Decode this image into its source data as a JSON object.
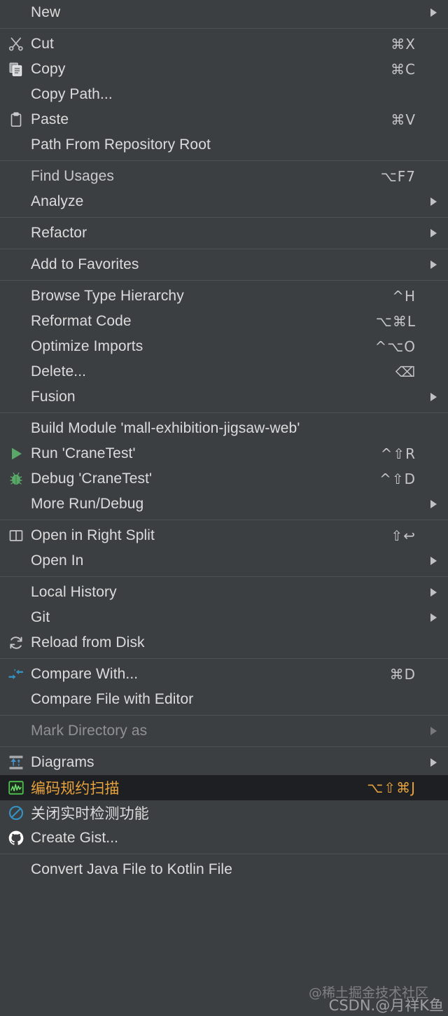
{
  "menu": {
    "accent_selected_text": "#e6a23c",
    "selected_background": "#1e1f22",
    "background": "#3c3f41",
    "groups": [
      {
        "name": "new-group",
        "items": [
          {
            "label": "New",
            "icon": "none",
            "shortcut": "",
            "submenu": true,
            "state": "bright"
          }
        ]
      },
      {
        "name": "clipboard-group",
        "items": [
          {
            "label": "Cut",
            "icon": "scissors-icon",
            "shortcut": "⌘X",
            "submenu": false,
            "state": "normal"
          },
          {
            "label": "Copy",
            "icon": "copy-icon",
            "shortcut": "⌘C",
            "submenu": false,
            "state": "normal"
          },
          {
            "label": "Copy Path...",
            "icon": "none",
            "shortcut": "",
            "submenu": false,
            "state": "normal"
          },
          {
            "label": "Paste",
            "icon": "clipboard-icon",
            "shortcut": "⌘V",
            "submenu": false,
            "state": "normal"
          },
          {
            "label": "Path From Repository Root",
            "icon": "none",
            "shortcut": "",
            "submenu": false,
            "state": "normal"
          }
        ]
      },
      {
        "name": "analyze-group",
        "items": [
          {
            "label": "Find Usages",
            "icon": "none",
            "shortcut": "⌥F7",
            "submenu": false,
            "state": "dim"
          },
          {
            "label": "Analyze",
            "icon": "none",
            "shortcut": "",
            "submenu": true,
            "state": "bright"
          }
        ]
      },
      {
        "name": "refactor-group",
        "items": [
          {
            "label": "Refactor",
            "icon": "none",
            "shortcut": "",
            "submenu": true,
            "state": "bright"
          }
        ]
      },
      {
        "name": "favorites-group",
        "items": [
          {
            "label": "Add to Favorites",
            "icon": "none",
            "shortcut": "",
            "submenu": true,
            "state": "bright"
          }
        ]
      },
      {
        "name": "code-group",
        "items": [
          {
            "label": "Browse Type Hierarchy",
            "icon": "none",
            "shortcut": "^H",
            "submenu": false,
            "state": "normal"
          },
          {
            "label": "Reformat Code",
            "icon": "none",
            "shortcut": "⌥⌘L",
            "submenu": false,
            "state": "normal"
          },
          {
            "label": "Optimize Imports",
            "icon": "none",
            "shortcut": "^⌥O",
            "submenu": false,
            "state": "normal"
          },
          {
            "label": "Delete...",
            "icon": "none",
            "shortcut": "⌫",
            "submenu": false,
            "state": "normal"
          },
          {
            "label": "Fusion",
            "icon": "none",
            "shortcut": "",
            "submenu": true,
            "state": "bright"
          }
        ]
      },
      {
        "name": "build-run-group",
        "items": [
          {
            "label": "Build Module 'mall-exhibition-jigsaw-web'",
            "icon": "none",
            "shortcut": "",
            "submenu": false,
            "state": "normal"
          },
          {
            "label": "Run 'CraneTest'",
            "icon": "run-icon",
            "shortcut": "^⇧R",
            "submenu": false,
            "state": "normal"
          },
          {
            "label": "Debug 'CraneTest'",
            "icon": "debug-icon",
            "shortcut": "^⇧D",
            "submenu": false,
            "state": "normal"
          },
          {
            "label": "More Run/Debug",
            "icon": "none",
            "shortcut": "",
            "submenu": true,
            "state": "bright"
          }
        ]
      },
      {
        "name": "open-group",
        "items": [
          {
            "label": "Open in Right Split",
            "icon": "split-pane-icon",
            "shortcut": "⇧↩",
            "submenu": false,
            "state": "normal"
          },
          {
            "label": "Open In",
            "icon": "none",
            "shortcut": "",
            "submenu": true,
            "state": "bright"
          }
        ]
      },
      {
        "name": "vcs-group",
        "items": [
          {
            "label": "Local History",
            "icon": "none",
            "shortcut": "",
            "submenu": true,
            "state": "bright"
          },
          {
            "label": "Git",
            "icon": "none",
            "shortcut": "",
            "submenu": true,
            "state": "bright"
          },
          {
            "label": "Reload from Disk",
            "icon": "reload-icon",
            "shortcut": "",
            "submenu": false,
            "state": "normal"
          }
        ]
      },
      {
        "name": "compare-group",
        "items": [
          {
            "label": "Compare With...",
            "icon": "compare-icon",
            "shortcut": "⌘D",
            "submenu": false,
            "state": "normal"
          },
          {
            "label": "Compare File with Editor",
            "icon": "none",
            "shortcut": "",
            "submenu": false,
            "state": "normal"
          }
        ]
      },
      {
        "name": "mark-directory-group",
        "items": [
          {
            "label": "Mark Directory as",
            "icon": "none",
            "shortcut": "",
            "submenu": true,
            "state": "disabled"
          }
        ]
      },
      {
        "name": "tools-group",
        "items": [
          {
            "label": "Diagrams",
            "icon": "diagrams-icon",
            "shortcut": "",
            "submenu": true,
            "state": "bright"
          },
          {
            "label": "编码规约扫描",
            "icon": "code-scan-icon",
            "shortcut": "⌥⇧⌘J",
            "submenu": false,
            "state": "selected",
            "cjk": true
          },
          {
            "label": "关闭实时检测功能",
            "icon": "disable-inspection-icon",
            "shortcut": "",
            "submenu": false,
            "state": "normal",
            "cjk": true
          },
          {
            "label": "Create Gist...",
            "icon": "github-icon",
            "shortcut": "",
            "submenu": false,
            "state": "normal"
          }
        ]
      },
      {
        "name": "kotlin-group",
        "items": [
          {
            "label": "Convert Java File to Kotlin File",
            "icon": "none",
            "shortcut": "",
            "submenu": false,
            "state": "normal"
          }
        ]
      }
    ]
  },
  "watermark": {
    "line1": "@稀土掘金技术社区",
    "line2": "CSDN.@月祥K鱼"
  }
}
